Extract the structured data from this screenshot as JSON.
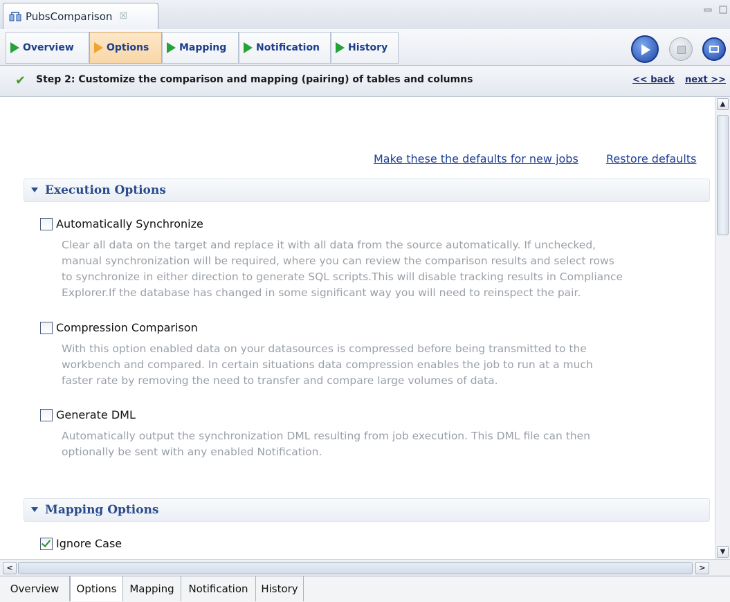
{
  "editor": {
    "tab_title": "PubsComparison",
    "close_glyph": "☒"
  },
  "nav_tabs": [
    "Overview",
    "Options",
    "Mapping",
    "Notification",
    "History"
  ],
  "nav_active": "Options",
  "controls": {
    "run_icon": "run-icon",
    "stop_icon": "stop-icon",
    "console_icon": "console-icon"
  },
  "step": {
    "check": "✔",
    "text": "Step 2: Customize the comparison and mapping (pairing) of tables and columns",
    "back": "<< back",
    "next": "next >>"
  },
  "links": {
    "make_defaults": "Make these the defaults for new jobs",
    "restore_defaults": "Restore defaults"
  },
  "execution_options": {
    "title": "Execution Options",
    "options": [
      {
        "label": "Automatically Synchronize",
        "checked": false,
        "desc": [
          "Clear all data on the target and replace it with all data from the source automatically. If unchecked,",
          "manual synchronization will be required, where you can review the comparison results and select rows",
          "to synchronize in either direction to generate SQL scripts.This will disable tracking results in Compliance",
          "Explorer.If the database has changed in some significant way you will need to reinspect the pair."
        ]
      },
      {
        "label": "Compression Comparison",
        "checked": false,
        "desc": [
          "With this option enabled data on your datasources is compressed before being transmitted to the",
          "workbench and compared. In certain situations data compression enables the job to run at a much",
          "faster rate by removing the need to transfer and compare large volumes of data."
        ]
      },
      {
        "label": "Generate DML",
        "checked": false,
        "desc": [
          "Automatically output the synchronization DML resulting from job execution. This DML file can then",
          "optionally be sent with any enabled Notification."
        ]
      }
    ]
  },
  "mapping_options": {
    "title": "Mapping Options",
    "options": [
      {
        "label": "Ignore Case",
        "checked": true
      }
    ]
  },
  "hscroll": {
    "left": "<",
    "right": ">",
    "grip": "|||"
  },
  "bottom_tabs": [
    "Overview",
    "Options",
    "Mapping",
    "Notification",
    "History"
  ],
  "bottom_active": "Options"
}
